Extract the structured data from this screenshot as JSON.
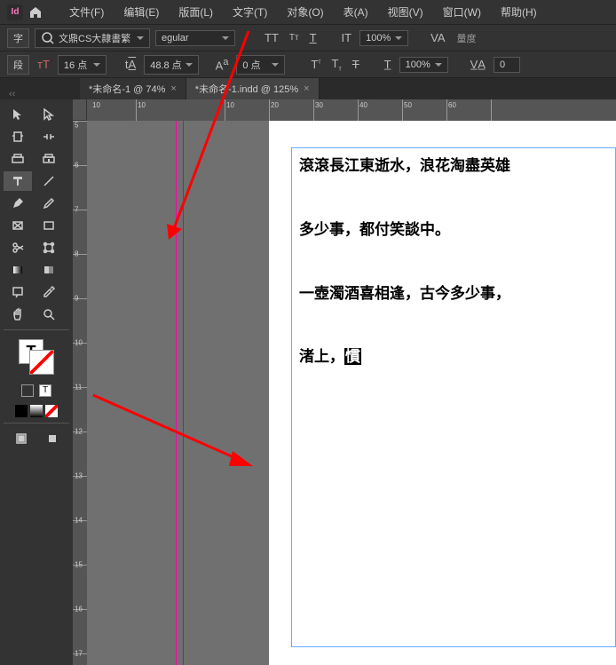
{
  "menubar": {
    "items": [
      {
        "label": "文件(F)"
      },
      {
        "label": "编辑(E)"
      },
      {
        "label": "版面(L)"
      },
      {
        "label": "文字(T)"
      },
      {
        "label": "对象(O)"
      },
      {
        "label": "表(A)"
      },
      {
        "label": "视图(V)"
      },
      {
        "label": "窗口(W)"
      },
      {
        "label": "帮助(H)"
      }
    ]
  },
  "control1": {
    "tab_label": "字",
    "font_name": "文鼎CS大隷書繁",
    "font_style": "egular",
    "zoom": "100%",
    "right_label": "量度"
  },
  "control2": {
    "tab_label": "段",
    "size_value": "16 点",
    "leading_value": "48.8 点",
    "tracking_value": "0 点",
    "zoom2": "100%",
    "right_value": "0"
  },
  "tabs": [
    {
      "label": "*未命名-1 @ 74%",
      "active": false
    },
    {
      "label": "*未命名-1.indd @ 125%",
      "active": true
    }
  ],
  "h_ruler_ticks": [
    "10",
    "10",
    "10",
    "20",
    "30",
    "40",
    "50",
    "60"
  ],
  "v_ruler_ticks": [
    "5",
    "6",
    "7",
    "8",
    "9",
    "10",
    "11",
    "12",
    "13",
    "14",
    "15",
    "16",
    "17"
  ],
  "document": {
    "lines": [
      "滾滾長江東逝水，浪花淘盡英雄",
      "多少事，都付笑談中。",
      "一壺濁酒喜相逢，古今多少事，",
      "渚上，"
    ],
    "cursor_char": "慣"
  },
  "icons": {
    "home": "home-icon",
    "arrow": "arrow-icon"
  }
}
